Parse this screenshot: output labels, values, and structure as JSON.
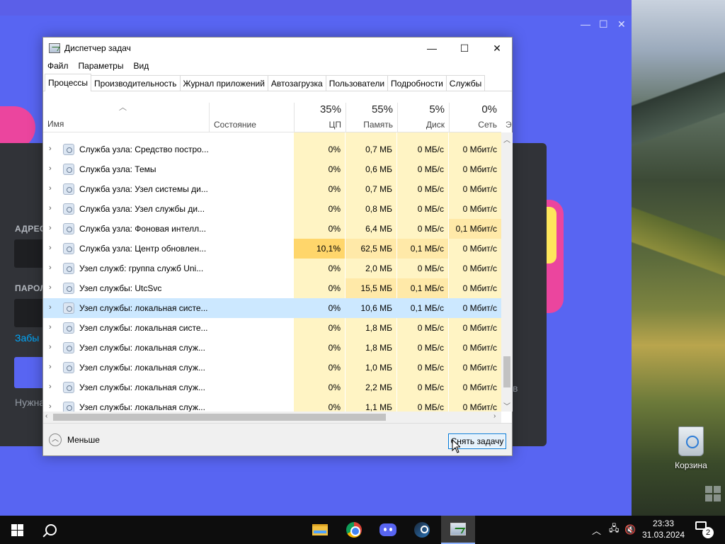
{
  "taskmgr": {
    "title": "Диспетчер задач",
    "menu": [
      "Файл",
      "Параметры",
      "Вид"
    ],
    "tabs": [
      "Процессы",
      "Производительность",
      "Журнал приложений",
      "Автозагрузка",
      "Пользователи",
      "Подробности",
      "Службы"
    ],
    "active_tab": "Процессы",
    "columns": {
      "name": "Имя",
      "status": "Состояние",
      "cpu": {
        "percent": "35%",
        "label": "ЦП"
      },
      "memory": {
        "percent": "55%",
        "label": "Память"
      },
      "disk": {
        "percent": "5%",
        "label": "Диск"
      },
      "network": {
        "percent": "0%",
        "label": "Сеть"
      },
      "extra": "Э"
    },
    "rows": [
      {
        "name": "Служба узла: Средство постро...",
        "cpu": "0%",
        "mem": "0,7 МБ",
        "disk": "0 МБ/с",
        "net": "0 Мбит/с"
      },
      {
        "name": "Служба узла: Темы",
        "cpu": "0%",
        "mem": "0,6 МБ",
        "disk": "0 МБ/с",
        "net": "0 Мбит/с"
      },
      {
        "name": "Служба узла: Узел системы ди...",
        "cpu": "0%",
        "mem": "0,7 МБ",
        "disk": "0 МБ/с",
        "net": "0 Мбит/с"
      },
      {
        "name": "Служба узла: Узел службы ди...",
        "cpu": "0%",
        "mem": "0,8 МБ",
        "disk": "0 МБ/с",
        "net": "0 Мбит/с"
      },
      {
        "name": "Служба узла: Фоновая интелл...",
        "cpu": "0%",
        "mem": "6,4 МБ",
        "disk": "0 МБ/с",
        "net": "0,1 Мбит/с"
      },
      {
        "name": "Служба узла: Центр обновлен...",
        "cpu": "10,1%",
        "mem": "62,5 МБ",
        "disk": "0,1 МБ/с",
        "net": "0 Мбит/с"
      },
      {
        "name": "Узел служб: группа служб Uni...",
        "cpu": "0%",
        "mem": "2,0 МБ",
        "disk": "0 МБ/с",
        "net": "0 Мбит/с"
      },
      {
        "name": "Узел службы: UtcSvc",
        "cpu": "0%",
        "mem": "15,5 МБ",
        "disk": "0,1 МБ/с",
        "net": "0 Мбит/с"
      },
      {
        "name": "Узел службы: локальная систе...",
        "cpu": "0%",
        "mem": "10,6 МБ",
        "disk": "0,1 МБ/с",
        "net": "0 Мбит/с"
      },
      {
        "name": "Узел службы: локальная систе...",
        "cpu": "0%",
        "mem": "1,8 МБ",
        "disk": "0 МБ/с",
        "net": "0 Мбит/с"
      },
      {
        "name": "Узел службы: локальная служ...",
        "cpu": "0%",
        "mem": "1,8 МБ",
        "disk": "0 МБ/с",
        "net": "0 Мбит/с"
      },
      {
        "name": "Узел службы: локальная служ...",
        "cpu": "0%",
        "mem": "1,0 МБ",
        "disk": "0 МБ/с",
        "net": "0 Мбит/с"
      },
      {
        "name": "Узел службы: локальная служ...",
        "cpu": "0%",
        "mem": "2,2 МБ",
        "disk": "0 МБ/с",
        "net": "0 Мбит/с"
      },
      {
        "name": "Узел службы: локальная служ...",
        "cpu": "0%",
        "mem": "1,1 МБ",
        "disk": "0 МБ/с",
        "net": "0 Мбит/с"
      }
    ],
    "selected_row": 8,
    "footer": {
      "less_label": "Меньше",
      "end_task_label": "Снять задачу"
    }
  },
  "discord": {
    "labels": {
      "address": "АДРЕС",
      "password": "ПАРОЛ",
      "forgot": "Забы",
      "need": "Нужна",
      "right_letter": "в"
    }
  },
  "desktop": {
    "recycle_bin": "Корзина"
  },
  "taskbar": {
    "time": "23:33",
    "date": "31.03.2024",
    "notifications": "2",
    "pinned": [
      "file-explorer-icon",
      "chrome-icon",
      "discord-icon",
      "steam-icon",
      "task-manager-icon"
    ]
  },
  "colors": {
    "cpu_heat_high": "#ffd66b",
    "heat_low": "#fff4c4",
    "selected": "#cce8ff",
    "discord_blurple": "#5865f2"
  }
}
